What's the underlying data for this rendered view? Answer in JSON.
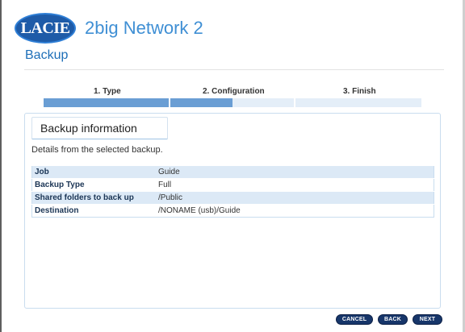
{
  "header": {
    "logo_text": "LACIE",
    "product_name": "2big Network 2"
  },
  "page": {
    "title": "Backup"
  },
  "stepper": {
    "steps": [
      {
        "label": "1. Type",
        "progress": 1.0
      },
      {
        "label": "2. Configuration",
        "progress": 0.5
      },
      {
        "label": "3. Finish",
        "progress": 0.0
      }
    ]
  },
  "panel": {
    "section_title": "Backup information",
    "details_text": "Details from the selected backup.",
    "rows": [
      {
        "key": "Job",
        "value": "Guide"
      },
      {
        "key": "Backup Type",
        "value": "Full"
      },
      {
        "key": "Shared folders to back up",
        "value": "/Public"
      },
      {
        "key": "Destination",
        "value": "/NONAME (usb)/Guide"
      }
    ]
  },
  "buttons": {
    "cancel": "CANCEL",
    "back": "BACK",
    "next": "NEXT"
  },
  "colors": {
    "accent": "#3f8fd4",
    "title_blue": "#1e6fb8",
    "progress_fill": "#6a9ed4",
    "button_navy": "#17366a"
  }
}
